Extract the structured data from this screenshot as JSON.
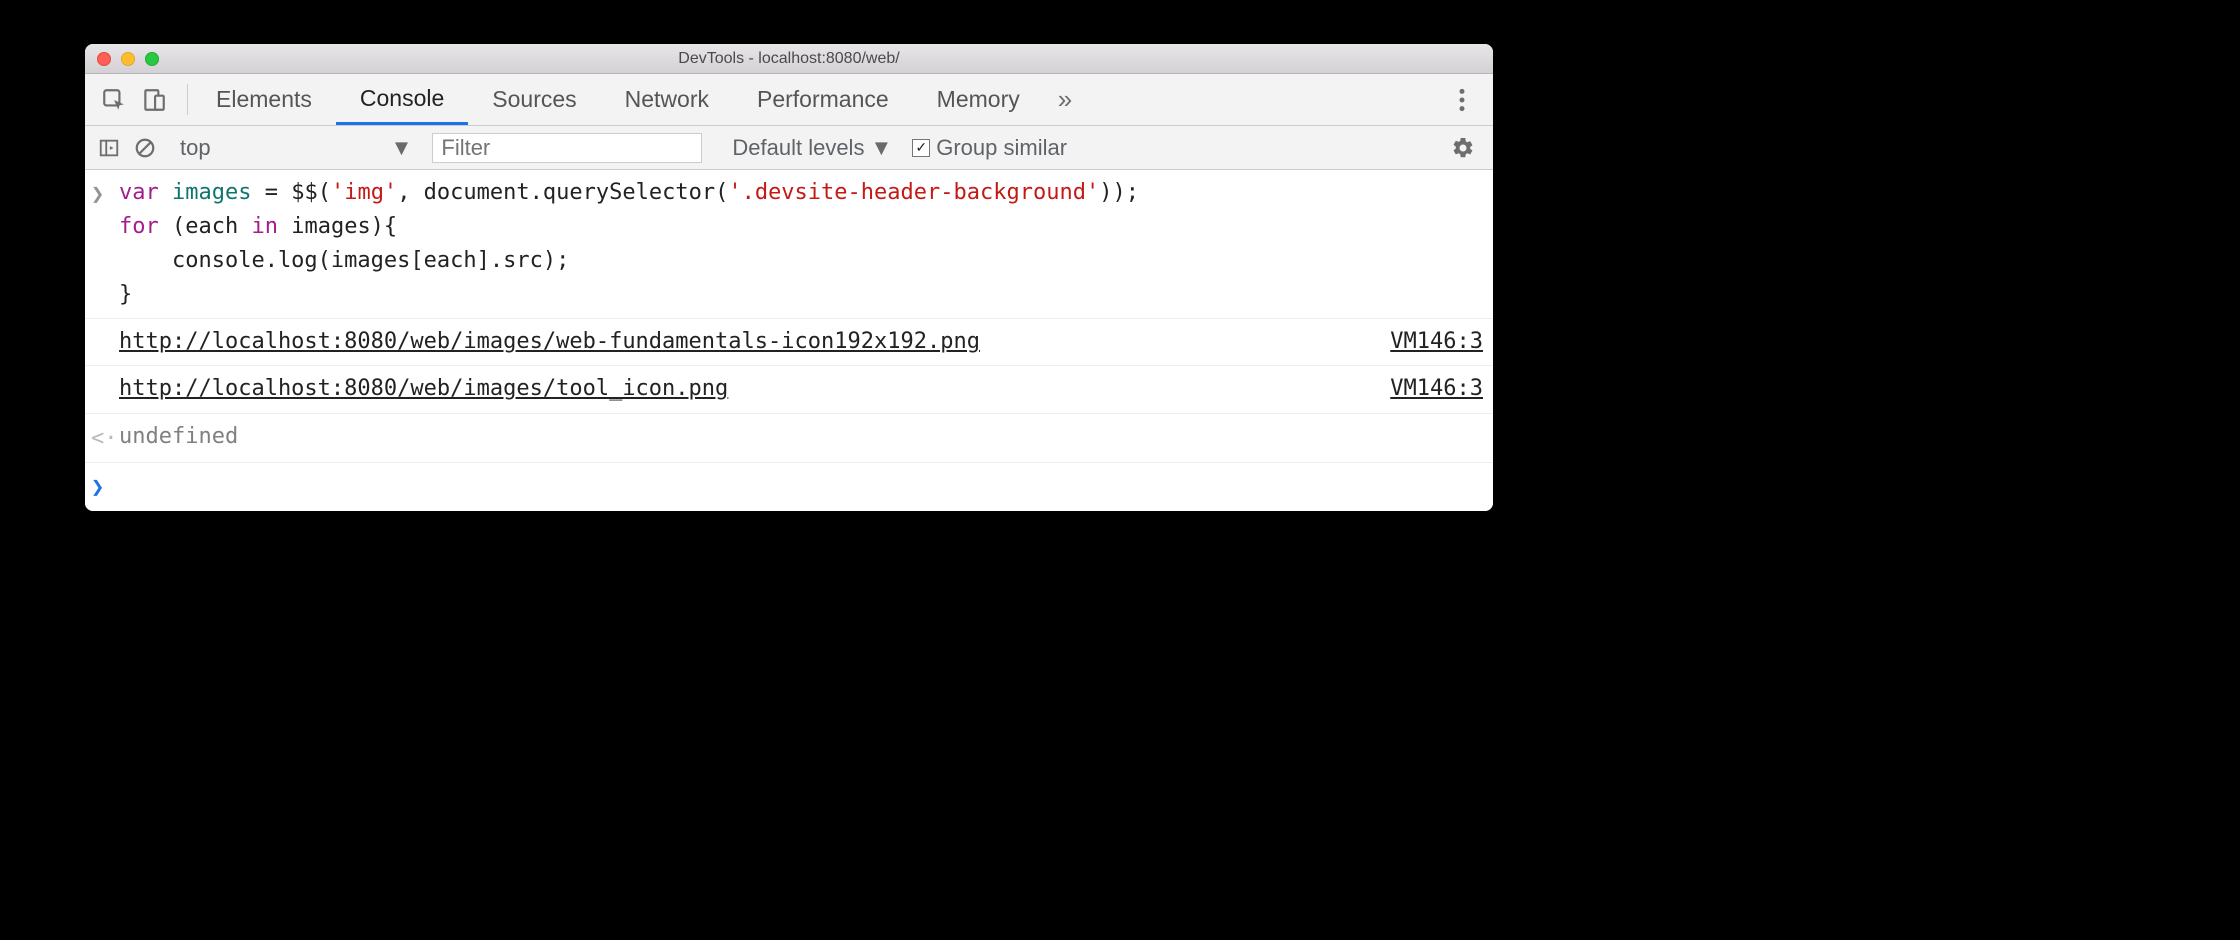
{
  "window": {
    "title": "DevTools - localhost:8080/web/"
  },
  "tabs": {
    "elements": "Elements",
    "console": "Console",
    "sources": "Sources",
    "network": "Network",
    "performance": "Performance",
    "memory": "Memory",
    "active": "console",
    "overflow_glyph": "»"
  },
  "filterbar": {
    "context": "top",
    "filter_placeholder": "Filter",
    "default_levels": "Default levels",
    "group_similar_label": "Group similar",
    "group_similar_checked": "✓"
  },
  "console": {
    "input_prompt": ">",
    "return_prompt": "<·",
    "new_prompt": ">",
    "code_lines": {
      "l1_pre": "var",
      "l1_name": " images ",
      "l1_eq": "= $$(",
      "l1_str1": "'img'",
      "l1_mid": ", document.querySelector(",
      "l1_str2": "'.devsite-header-background'",
      "l1_post": "));",
      "l2_pre": "for",
      "l2_mid1": " (each ",
      "l2_in": "in",
      "l2_mid2": " images){",
      "l3": "    console.log(images[each].src);",
      "l4": "}"
    },
    "outputs": [
      {
        "msg": "http://localhost:8080/web/images/web-fundamentals-icon192x192.png",
        "src": "VM146:3"
      },
      {
        "msg": "http://localhost:8080/web/images/tool_icon.png",
        "src": "VM146:3"
      }
    ],
    "return_value": "undefined"
  }
}
